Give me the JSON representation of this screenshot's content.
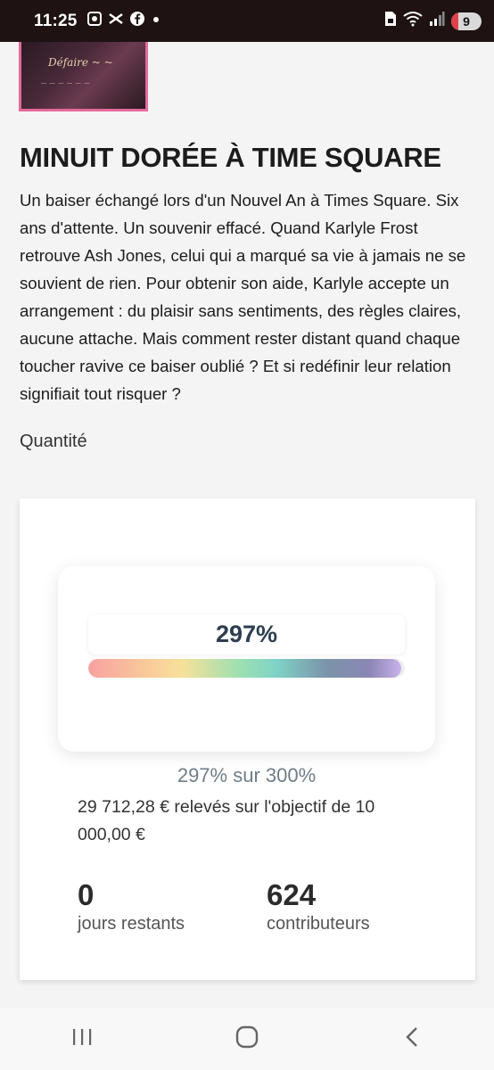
{
  "status_bar": {
    "time": "11:25",
    "left_icons": [
      "screenshot-icon",
      "capcut-icon",
      "facebook-icon",
      "dot-icon"
    ],
    "right_icons": [
      "sim-icon",
      "wifi-icon",
      "signal-icon"
    ],
    "battery": "9",
    "battery_color": "#e0424b"
  },
  "product": {
    "title": "MINUIT DORÉE À TIME SQUARE",
    "description": "Un baiser échangé lors d'un Nouvel An à Times Square. Six ans d'attente. Un souvenir effacé. Quand Karlyle Frost retrouve Ash Jones, celui qui a marqué sa vie à jamais ne se souvient de rien. Pour obtenir son aide, Karlyle accepte un arrangement : du plaisir sans sentiments, des règles claires, aucune attache. Mais comment rester distant quand chaque toucher ravive ce baiser oublié ? Et si redéfinir leur relation signifiait tout risquer ?",
    "quantity_label": "Quantité"
  },
  "funding": {
    "percent_label": "297%",
    "progress_fraction": 0.99,
    "progress_text": "297% sur 300%",
    "raised_text": "29 712,28 € relevés sur l'objectif de 10 000,00 €",
    "days_remaining": "0",
    "days_label": "jours restants",
    "contributors": "624",
    "contributors_label": "contributeurs"
  },
  "nav": {
    "buttons": [
      "recent-apps-icon",
      "home-icon",
      "back-icon"
    ]
  }
}
